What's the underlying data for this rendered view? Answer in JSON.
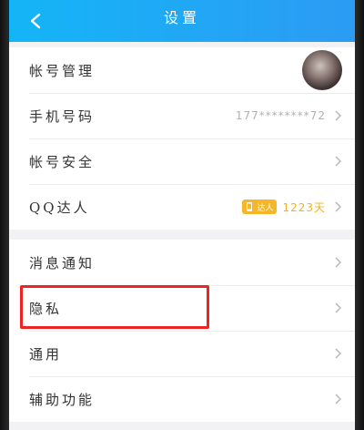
{
  "header": {
    "title": "设置",
    "back_icon": "chevron-left-icon"
  },
  "group1": [
    {
      "label": "帐号管理",
      "value": "",
      "type": "avatar"
    },
    {
      "label": "手机号码",
      "value": "177********72",
      "type": "value"
    },
    {
      "label": "帐号安全",
      "value": "",
      "type": "plain"
    },
    {
      "label": "QQ达人",
      "value": "1223天",
      "badge": "达人",
      "type": "badge"
    }
  ],
  "group2": [
    {
      "label": "消息通知"
    },
    {
      "label": "隐私"
    },
    {
      "label": "通用"
    },
    {
      "label": "辅助功能"
    }
  ],
  "colors": {
    "header": "#1aaaf5",
    "highlight": "#ee2424",
    "badge": "#f6b629"
  }
}
